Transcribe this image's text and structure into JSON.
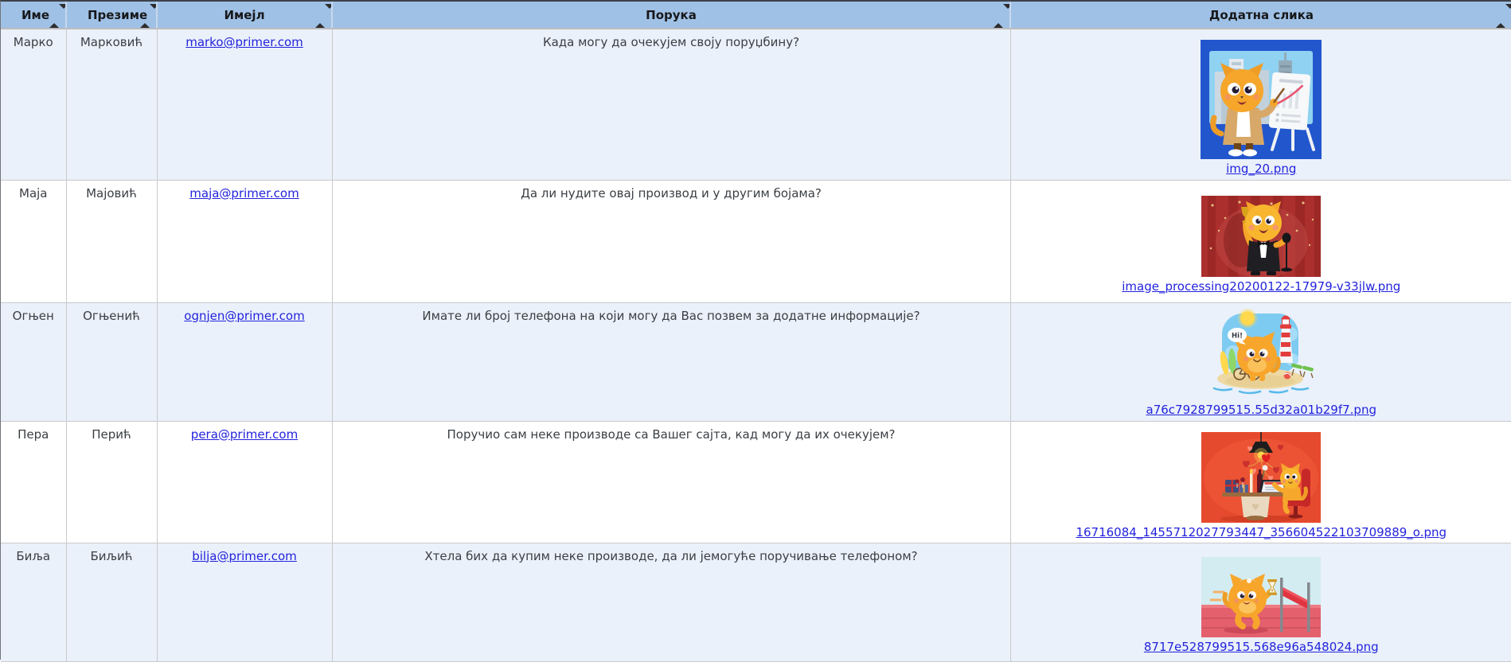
{
  "table": {
    "headers": [
      {
        "label": "Име"
      },
      {
        "label": "Презиме"
      },
      {
        "label": "Имејл"
      },
      {
        "label": "Порука"
      },
      {
        "label": "Додатна слика"
      }
    ],
    "rows": [
      {
        "first_name": "Марко",
        "last_name": "Марковић",
        "email": "marko@primer.com",
        "message": "Када могу да очекујем своју поруџбину?",
        "image_filename": "img_20.png",
        "image_name": "cat-presentation-illustration"
      },
      {
        "first_name": "Маја",
        "last_name": "Мајовић",
        "email": "maja@primer.com",
        "message": "Да ли нудите овај производ и у другим бојама?",
        "image_filename": "image_processing20200122-17979-v33jlw.png",
        "image_name": "cat-award-stage-illustration"
      },
      {
        "first_name": "Огњен",
        "last_name": "Огњенић",
        "email": "ognjen@primer.com",
        "message": "Имате ли број телефона на који могу да Вас позвем за додатне информације?",
        "image_filename": "a76c7928799515.55d32a01b29f7.png",
        "image_name": "cat-beach-lighthouse-illustration",
        "speech_text": "Hi!"
      },
      {
        "first_name": "Пера",
        "last_name": "Перић",
        "email": "pera@primer.com",
        "message": "Поручио сам неке производе са Вашег сајта, кад могу да их очекујем?",
        "image_filename": "16716084_1455712027793447_356604522103709889_o.png",
        "image_name": "cat-valentine-desk-illustration"
      },
      {
        "first_name": "Биља",
        "last_name": "Биљић",
        "email": "bilja@primer.com",
        "message": "Хтела бих да купим неке производе, да ли јемогуће поручивање телефоном?",
        "image_filename": "8717e528799515.568e96a548024.png",
        "image_name": "cat-finish-line-illustration"
      }
    ]
  },
  "icons": {
    "sort": "sort-icon"
  },
  "colors": {
    "header_bg": "#a0c1e6",
    "row_alt_bg": "#eaf1fa",
    "row_bg": "#ffffff",
    "link": "#2323dd",
    "border": "#c9c9c9",
    "header_text": "#16181a",
    "body_text": "#3a3f44"
  }
}
